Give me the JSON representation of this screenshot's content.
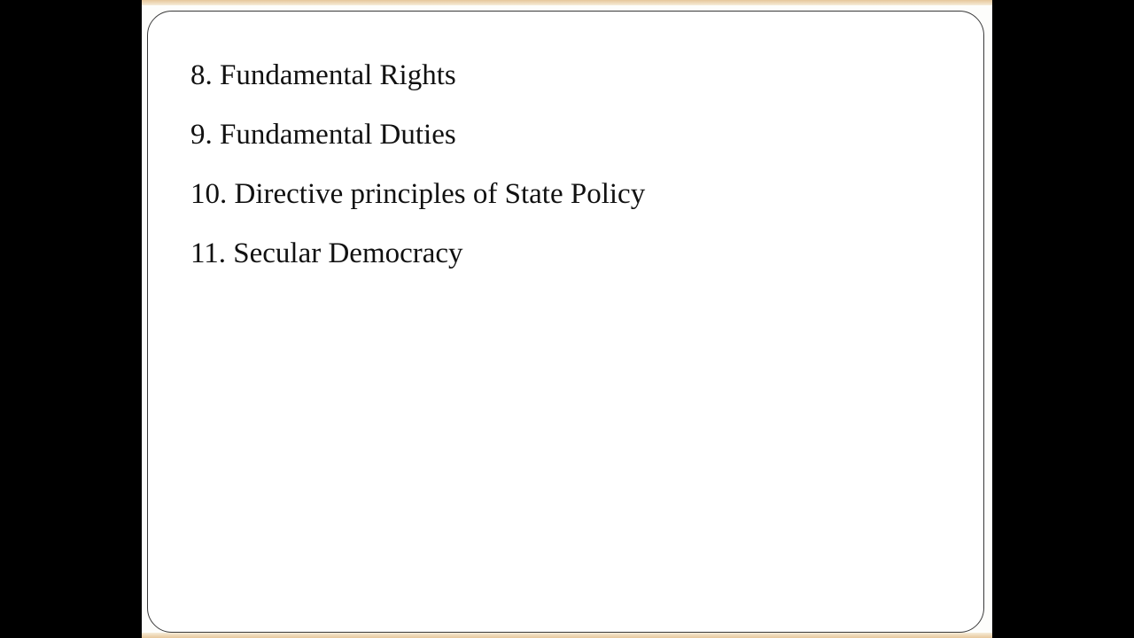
{
  "slide": {
    "items": [
      "8. Fundamental Rights",
      "9. Fundamental Duties",
      "10. Directive principles of State Policy",
      "11. Secular Democracy"
    ]
  },
  "colors": {
    "letterbox": "#000000",
    "slide_background": "#fdfdfb",
    "accent_band": "#e6c79a",
    "frame_border": "#3a3a3a",
    "text": "#111111"
  }
}
